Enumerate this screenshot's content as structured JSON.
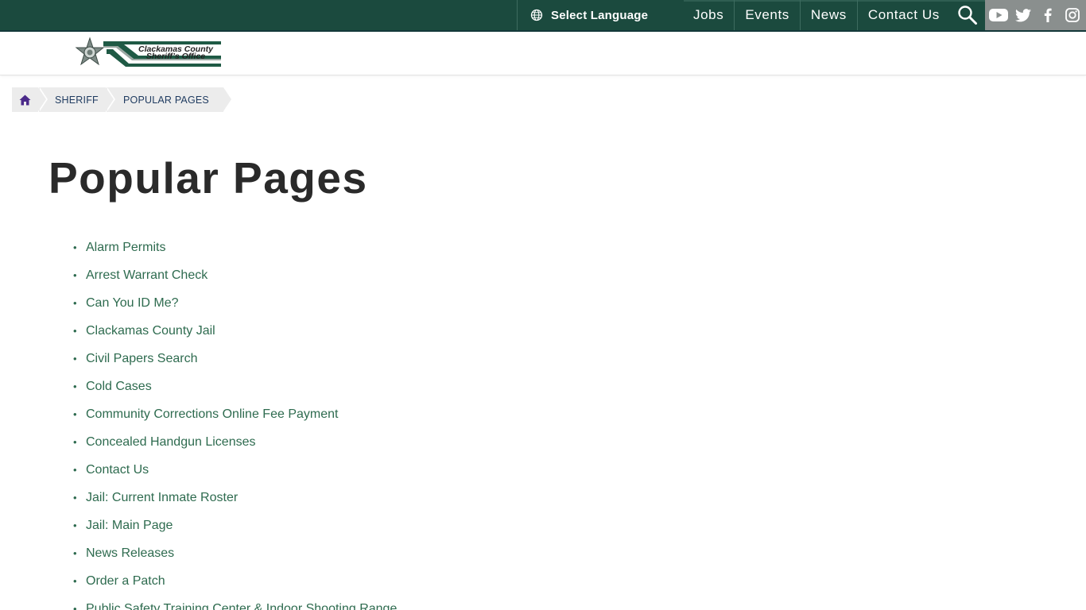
{
  "topbar": {
    "language_label": "Select Language",
    "nav": [
      "Jobs",
      "Events",
      "News",
      "Contact Us"
    ],
    "social_icons": [
      "youtube-icon",
      "twitter-icon",
      "facebook-icon",
      "instagram-icon"
    ]
  },
  "logo": {
    "line1": "Clackamas County",
    "line2": "Sheriff’s Office"
  },
  "breadcrumb": {
    "items": [
      "SHERIFF",
      "POPULAR PAGES"
    ]
  },
  "page": {
    "title": "Popular Pages",
    "links": [
      "Alarm Permits",
      "Arrest Warrant Check",
      "Can You ID Me?",
      "Clackamas County Jail",
      "Civil Papers Search",
      "Cold Cases",
      "Community Corrections Online Fee Payment",
      "Concealed Handgun Licenses",
      "Contact Us",
      "Jail: Current Inmate Roster",
      "Jail: Main Page",
      "News Releases",
      "Order a Patch",
      "Public Safety Training Center & Indoor Shooting Range"
    ]
  },
  "colors": {
    "topbar": "#1b4a3e",
    "link": "#2e6b4f",
    "breadcrumb_text": "#1e3a5f",
    "home_icon": "#4b2a8a",
    "social_bg": "#8a8f8e"
  }
}
